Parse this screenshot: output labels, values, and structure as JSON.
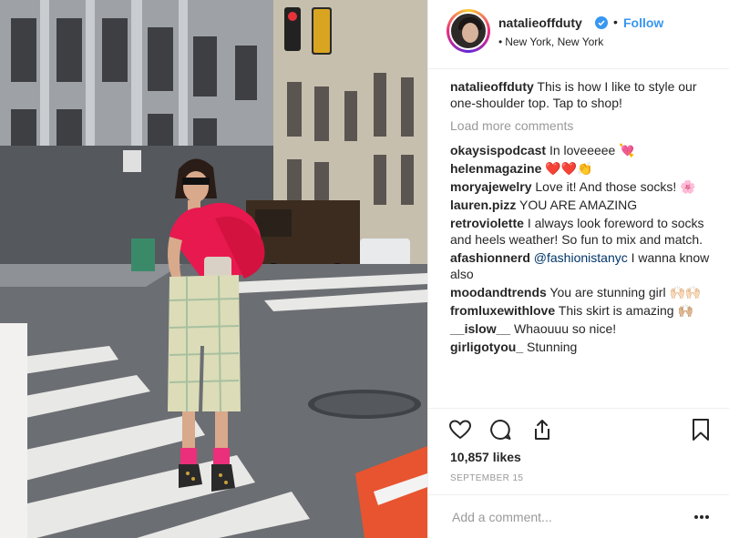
{
  "post": {
    "username": "natalieoffduty",
    "follow_label": "Follow",
    "dot": "•",
    "location": "New York, New York",
    "location_bullet": "•"
  },
  "caption": {
    "username": "natalieoffduty",
    "text": "This is how I like to style our one-shoulder top. Tap to shop!"
  },
  "load_more_label": "Load more comments",
  "comments": [
    {
      "username": "okaysispodcast",
      "text": "In loveeeee 💘"
    },
    {
      "username": "helenmagazine",
      "text": "❤️❤️👏"
    },
    {
      "username": "moryajewelry",
      "text": "Love it! And those socks! 🌸"
    },
    {
      "username": "lauren.pizz",
      "text": "YOU ARE AMAZING"
    },
    {
      "username": "retroviolette",
      "text": "I always look foreword to socks and heels weather! So fun to mix and match."
    },
    {
      "username": "afashionnerd",
      "mention": "@fashionistanyc",
      "text": "I wanna know also"
    },
    {
      "username": "moodandtrends",
      "text": "You are stunning girl 🙌🏻🙌🏻"
    },
    {
      "username": "fromluxewithlove",
      "text": "This skirt is amazing 🙌🏼"
    },
    {
      "username": "__islow__",
      "text": "Whaouuu so nice!"
    },
    {
      "username": "girligotyou_",
      "text": "Stunning"
    }
  ],
  "likes": "10,857 likes",
  "date": "SEPTEMBER 15",
  "add_comment_placeholder": "Add a comment...",
  "icons": {
    "verified": "verified-badge-icon",
    "like": "heart-icon",
    "comment": "comment-bubble-icon",
    "share": "share-icon",
    "save": "bookmark-icon",
    "more": "more-options-icon"
  },
  "colors": {
    "link": "#3897f0",
    "text": "#262626",
    "muted": "#999999",
    "top": "#e8194f",
    "verified": "#3897f0"
  }
}
